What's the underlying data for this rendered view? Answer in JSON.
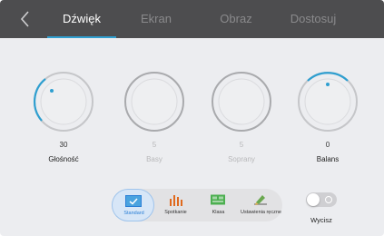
{
  "header": {
    "tabs": [
      {
        "label": "Dźwięk",
        "active": true
      },
      {
        "label": "Ekran",
        "active": false
      },
      {
        "label": "Obraz",
        "active": false
      },
      {
        "label": "Dostosuj",
        "active": false
      }
    ]
  },
  "knobs": [
    {
      "label": "Głośność",
      "value": "30",
      "enabled": true
    },
    {
      "label": "Basy",
      "value": "5",
      "enabled": false
    },
    {
      "label": "Soprany",
      "value": "5",
      "enabled": false
    },
    {
      "label": "Balans",
      "value": "0",
      "enabled": true
    }
  ],
  "modes": [
    {
      "label": "Standard",
      "icon": "check-icon",
      "active": true
    },
    {
      "label": "Spotkanie",
      "icon": "bar-chart-icon",
      "active": false
    },
    {
      "label": "Klasa",
      "icon": "board-icon",
      "active": false
    },
    {
      "label": "Ustawienia ręczne",
      "icon": "pencil-icon",
      "active": false
    }
  ],
  "mute": {
    "label": "Wycisz",
    "on": false
  },
  "colors": {
    "accent": "#2f9fd0",
    "header_bg": "#4d4d4f",
    "panel_bg": "#ecedf0",
    "active_mode_text": "#2b7fd6",
    "meeting_icon": "#e06a1e",
    "class_icon": "#4caf50",
    "manual_icon": "#6aa84f"
  }
}
